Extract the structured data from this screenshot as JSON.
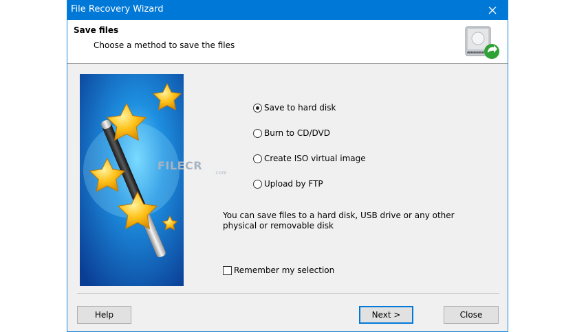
{
  "window": {
    "title": "File Recovery Wizard",
    "close_glyph": "✕"
  },
  "header": {
    "title": "Save files",
    "subtitle": "Choose a method to save the files",
    "icon": "hard-drive-save-icon"
  },
  "illustration": {
    "icon": "magic-wand-stars-icon"
  },
  "watermark": {
    "brand": "FILECR",
    "domain": ".com"
  },
  "options": [
    {
      "label": "Save to hard disk",
      "selected": true
    },
    {
      "label": "Burn to CD/DVD",
      "selected": false
    },
    {
      "label": "Create ISO virtual image",
      "selected": false
    },
    {
      "label": "Upload by FTP",
      "selected": false
    }
  ],
  "description": "You can save files to a hard disk, USB drive or any other physical or removable disk",
  "remember": {
    "label": "Remember my selection",
    "checked": false
  },
  "buttons": {
    "help": "Help",
    "next": "Next >",
    "close": "Close"
  }
}
